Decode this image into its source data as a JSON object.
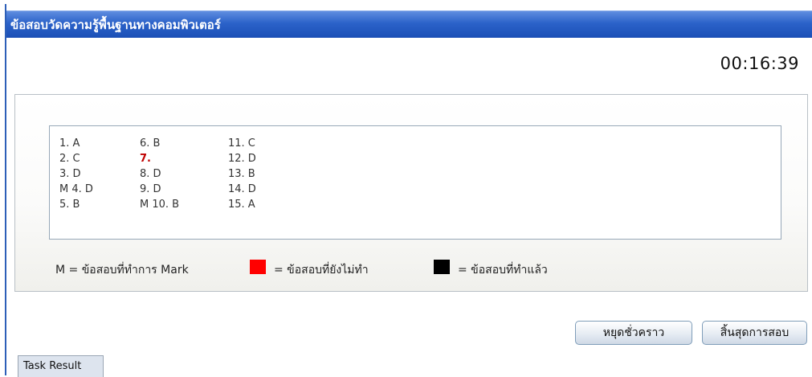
{
  "window": {
    "title": "ข้อสอบวัดความรู้พื้นฐานทางคอมพิวเตอร์"
  },
  "timer": "00:16:39",
  "answers": {
    "columns": [
      [
        "1. A",
        "2. C",
        "3. D",
        "M 4. D",
        "5. B"
      ],
      [
        "6. B",
        "7.",
        "8. D",
        "9. D",
        "M 10. B"
      ],
      [
        "11. C",
        "12. D",
        "13. B",
        "14. D",
        "15. A"
      ]
    ]
  },
  "legend": {
    "marked": "M = ข้อสอบที่ทำการ Mark",
    "unanswered": "= ข้อสอบที่ยังไม่ทำ",
    "answered": "= ข้อสอบที่ทำแล้ว"
  },
  "colors": {
    "unanswered": "#ff0000",
    "answered": "#000000"
  },
  "buttons": {
    "pause": "หยุดชั่วคราว",
    "finish": "สิ้นสุดการสอบ"
  },
  "tabs": {
    "task_result": "Task Result"
  }
}
